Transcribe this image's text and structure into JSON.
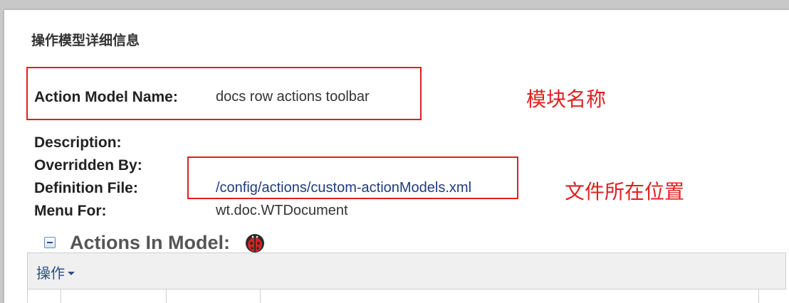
{
  "panel": {
    "title": "操作模型详细信息"
  },
  "details": {
    "action_model_name": {
      "label": "Action Model Name:",
      "value": "docs row actions toolbar"
    },
    "description": {
      "label": "Description:",
      "value": ""
    },
    "overridden_by": {
      "label": "Overridden By:",
      "value": ""
    },
    "definition_file": {
      "label": "Definition File:",
      "value": "/config/actions/custom-actionModels.xml"
    },
    "menu_for": {
      "label": "Menu For:",
      "value": "wt.doc.WTDocument"
    }
  },
  "annotations": {
    "module_name": "模块名称",
    "file_location": "文件所在位置",
    "color": "#e02020"
  },
  "actions_section": {
    "title": "Actions In Model:",
    "icon": "ladybug-icon",
    "toolbar_menu_label": "操作"
  },
  "colors": {
    "link": "#1f3d7a",
    "accent": "#2c4f86"
  }
}
